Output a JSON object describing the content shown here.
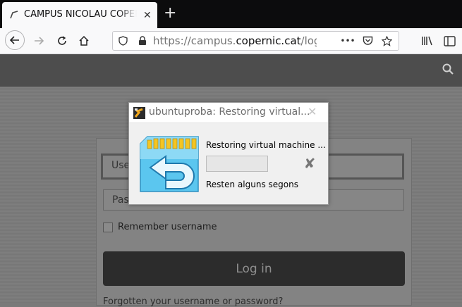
{
  "browser": {
    "tab_title": "CAMPUS NICOLAU COPERNIC",
    "tab_close": "✕",
    "new_tab": "+",
    "url_prefix": "https://campus.",
    "url_domain": "copernic.cat",
    "url_path": "/login/index.php",
    "page_actions": "•••"
  },
  "login": {
    "username_placeholder": "Username",
    "password_placeholder": "Password",
    "remember_label": "Remember username",
    "login_button": "Log in",
    "forgot_link": "Forgotten your username or password?"
  },
  "dialog": {
    "title": "ubuntuproba: Restoring virtual...",
    "close": "✕",
    "message": "Restoring virtual machine ...",
    "progress": 0,
    "cancel": "✘",
    "remaining": "Resten alguns segons"
  },
  "colors": {
    "accent": "#4cc3f0",
    "dark_button": "#2c2c2c"
  }
}
